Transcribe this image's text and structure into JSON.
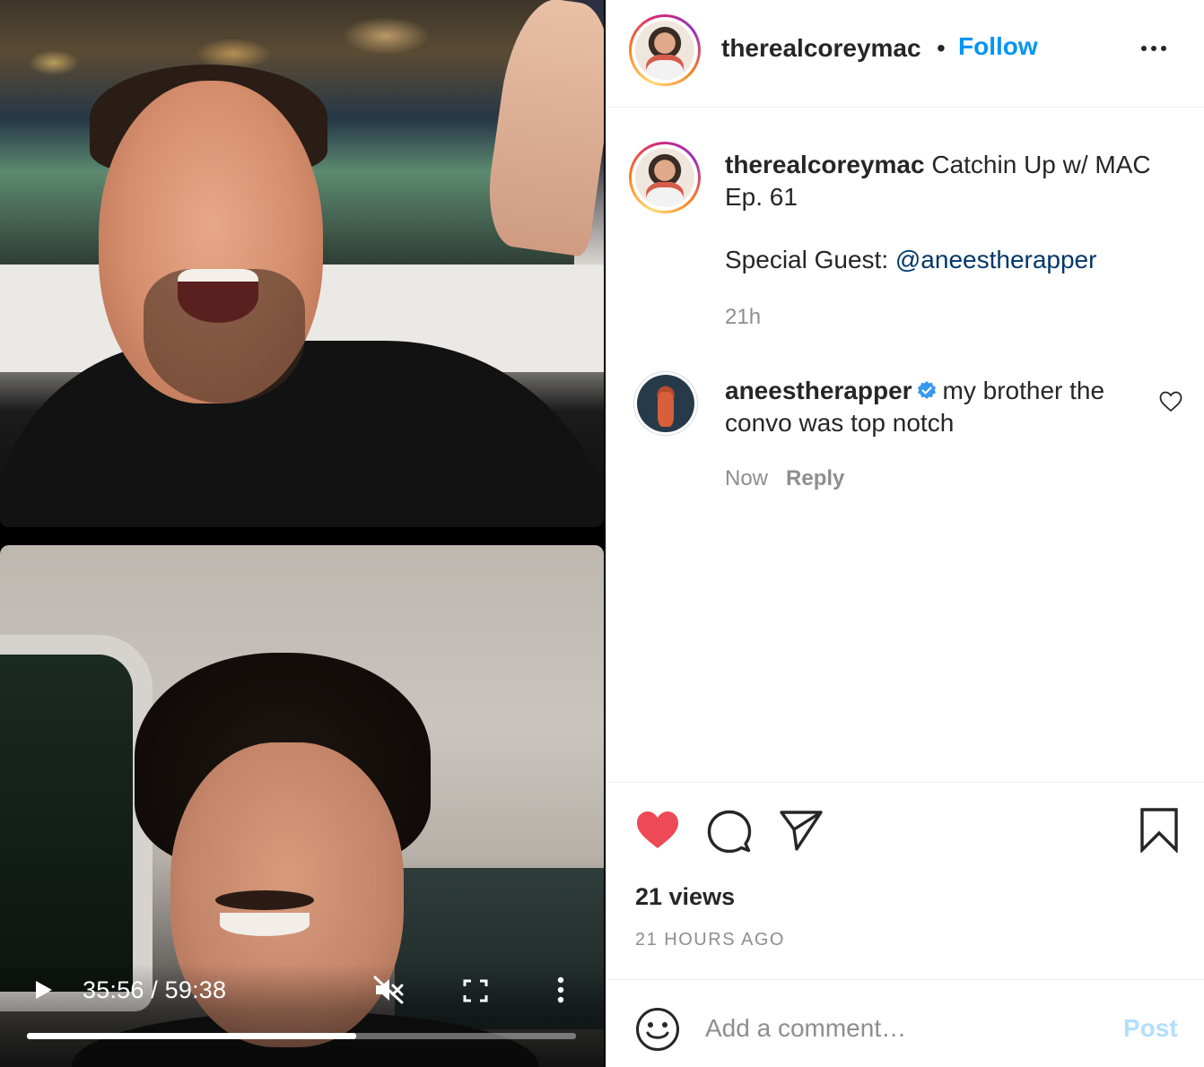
{
  "video": {
    "time_current": "35:56",
    "time_total": "59:38",
    "time_display": "35:56 / 59:38",
    "progress_fraction": 0.6,
    "muted": true
  },
  "header": {
    "username": "therealcoreymac",
    "separator": "•",
    "follow_label": "Follow"
  },
  "caption": {
    "username": "therealcoreymac",
    "title": "Catchin Up w/ MAC Ep. 61",
    "guest_prefix": "Special Guest: ",
    "guest_mention": "@aneestherapper",
    "time": "21h"
  },
  "comment": {
    "username": "aneestherapper",
    "verified": true,
    "text": "my brother the convo was top notch",
    "time": "Now",
    "reply_label": "Reply"
  },
  "actions": {
    "liked": true,
    "views": "21 views",
    "ago": "21 HOURS AGO"
  },
  "composer": {
    "placeholder": "Add a comment…",
    "post_label": "Post"
  },
  "colors": {
    "accent": "#0095f6",
    "like": "#ed4956",
    "post_disabled": "#b2dffc",
    "mention": "#00376b",
    "muted_text": "#8e8e8e"
  },
  "icons": [
    "play-icon",
    "volume-muted-icon",
    "fullscreen-icon",
    "more-vertical-icon",
    "more-horizontal-icon",
    "verified-badge-icon",
    "heart-outline-icon",
    "heart-filled-icon",
    "comment-icon",
    "share-icon",
    "bookmark-icon",
    "emoji-icon"
  ]
}
